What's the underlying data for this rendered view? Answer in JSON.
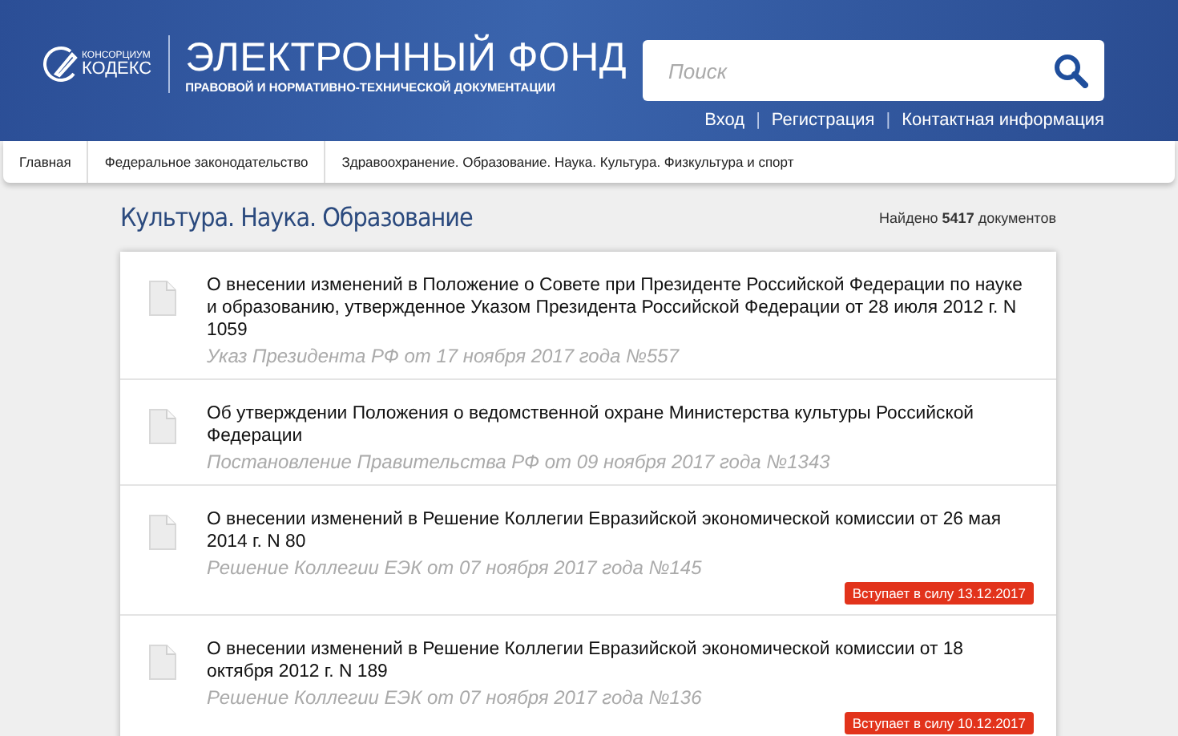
{
  "header": {
    "logo": {
      "small": "КОНСОРЦИУМ",
      "name": "КОДЕКС"
    },
    "title": "ЭЛЕКТРОННЫЙ ФОНД",
    "subtitle": "ПРАВОВОЙ И НОРМАТИВНО-ТЕХНИЧЕСКОЙ ДОКУМЕНТАЦИИ"
  },
  "search": {
    "placeholder": "Поиск"
  },
  "top_links": [
    {
      "kind": "link",
      "text": "Вход"
    },
    {
      "kind": "separator",
      "text": "|"
    },
    {
      "kind": "link",
      "text": "Регистрация"
    },
    {
      "kind": "separator",
      "text": "|"
    },
    {
      "kind": "link",
      "text": "Контактная информация"
    }
  ],
  "nav": [
    "Главная",
    "Федеральное законодательство",
    "Здравоохранение. Образование. Наука. Культура. Физкультура и спорт"
  ],
  "page_title": "Культура. Наука. Образование",
  "found": "Найдено **5417** документов",
  "documents": [
    {
      "title": "О внесении изменений в Положение о Совете при Президенте Российской Федерации по науке и образованию, утвержденное Указом Президента Российской Федерации от 28 июля 2012 г. N 1059",
      "source": "Указ Президента РФ от 17 ноября 2017 года №557"
    },
    {
      "title": "Об утверждении Положения о ведомственной охране Министерства культуры Российской Федерации",
      "source": "Постановление Правительства РФ от 09 ноября 2017 года №1343"
    },
    {
      "title": "О внесении изменений в Решение Коллегии Евразийской экономической комиссии от 26 мая 2014 г. N 80",
      "source": "Решение Коллегии ЕЭК от 07 ноября 2017 года №145",
      "badge": "Вступает в силу 13.12.2017"
    },
    {
      "title": "О внесении изменений в Решение Коллегии Евразийской экономической комиссии от 18 октября 2012 г. N 189",
      "source": "Решение Коллегии ЕЭК от 07 ноября 2017 года №136",
      "badge": "Вступает в силу 10.12.2017"
    }
  ]
}
